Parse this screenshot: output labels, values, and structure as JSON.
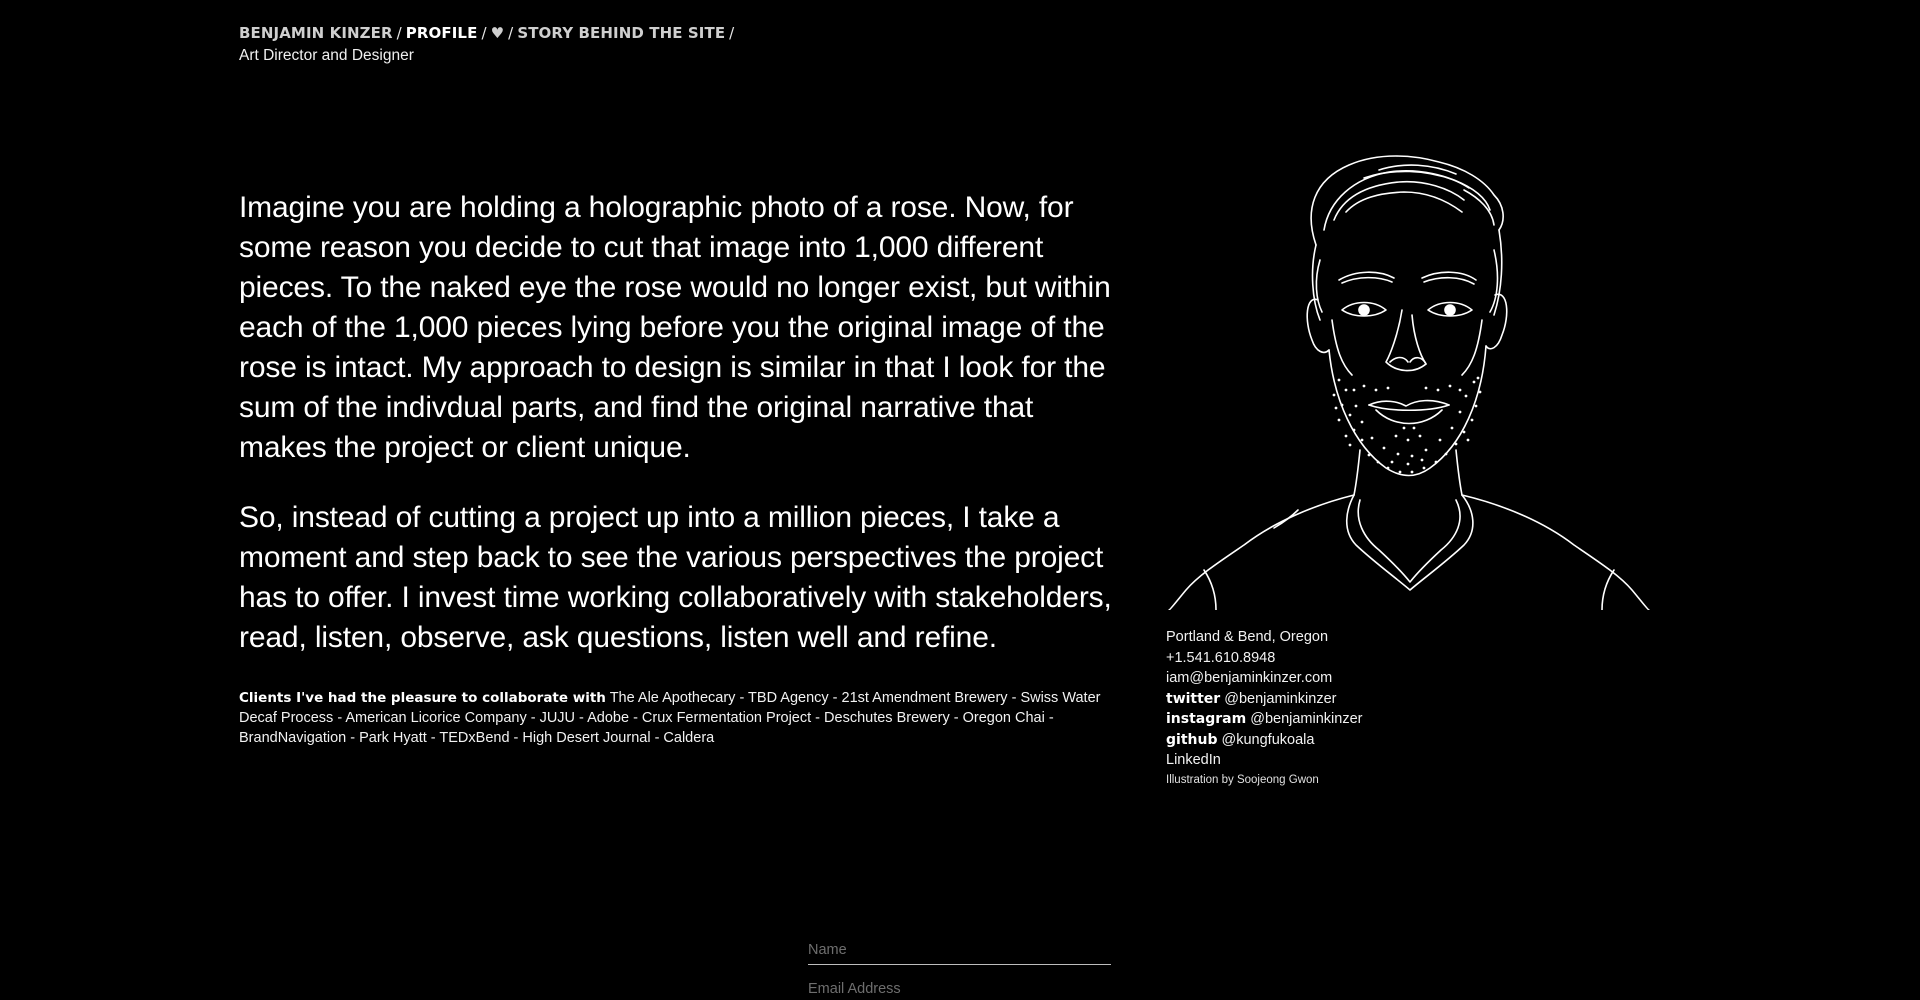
{
  "nav": {
    "name": "BENJAMIN KINZER",
    "profile": "PROFILE",
    "heart": "♥",
    "story": "STORY BEHIND THE SITE",
    "separator": "/"
  },
  "subtitle": "Art Director and Designer",
  "intro": {
    "paragraph_1": "Imagine you are holding a holographic photo of a rose. Now, for some reason you decide to cut that image into 1,000 different pieces. To the naked eye the rose would no longer exist, but within each of the 1,000 pieces lying before you the original image of the rose is intact. My approach to design is similar in that I look for the sum of the indivdual parts, and find the original narrative that makes the project or client unique.",
    "paragraph_2": "So, instead of cutting a project up into a million pieces, I take a moment and step back to see the various perspectives the project has to offer. I invest time working collaboratively with stakeholders, read, listen, observe, ask questions, listen well and refine."
  },
  "clients": {
    "lead": "Clients I've had the pleasure to collaborate with",
    "list": "The Ale Apothecary - TBD Agency - 21st Amendment Brewery - Swiss Water Decaf Process - American Licorice Company - JUJU - Adobe - Crux Fermentation Project - Deschutes Brewery - Oregon Chai - BrandNavigation - Park Hyatt - TEDxBend - High Desert Journal - Caldera"
  },
  "contact": {
    "location": "Portland & Bend, Oregon",
    "phone": "+1.541.610.8948",
    "email": "iam@benjaminkinzer.com",
    "twitter_label": "twitter",
    "twitter_handle": "@benjaminkinzer",
    "instagram_label": "instagram",
    "instagram_handle": "@benjaminkinzer",
    "github_label": "github",
    "github_handle": "@kungfukoala",
    "linkedin": "LinkedIn",
    "credit": "Illustration by Soojeong Gwon"
  },
  "form": {
    "name_placeholder": "Name",
    "email_placeholder": "Email Address"
  },
  "colors": {
    "background": "#000000",
    "text": "#ffffff",
    "nav_text": "#cfcfcf",
    "placeholder": "#6e6e6e",
    "underline": "#bdbdbd"
  },
  "icons": {
    "portrait": "line-drawing-portrait"
  }
}
